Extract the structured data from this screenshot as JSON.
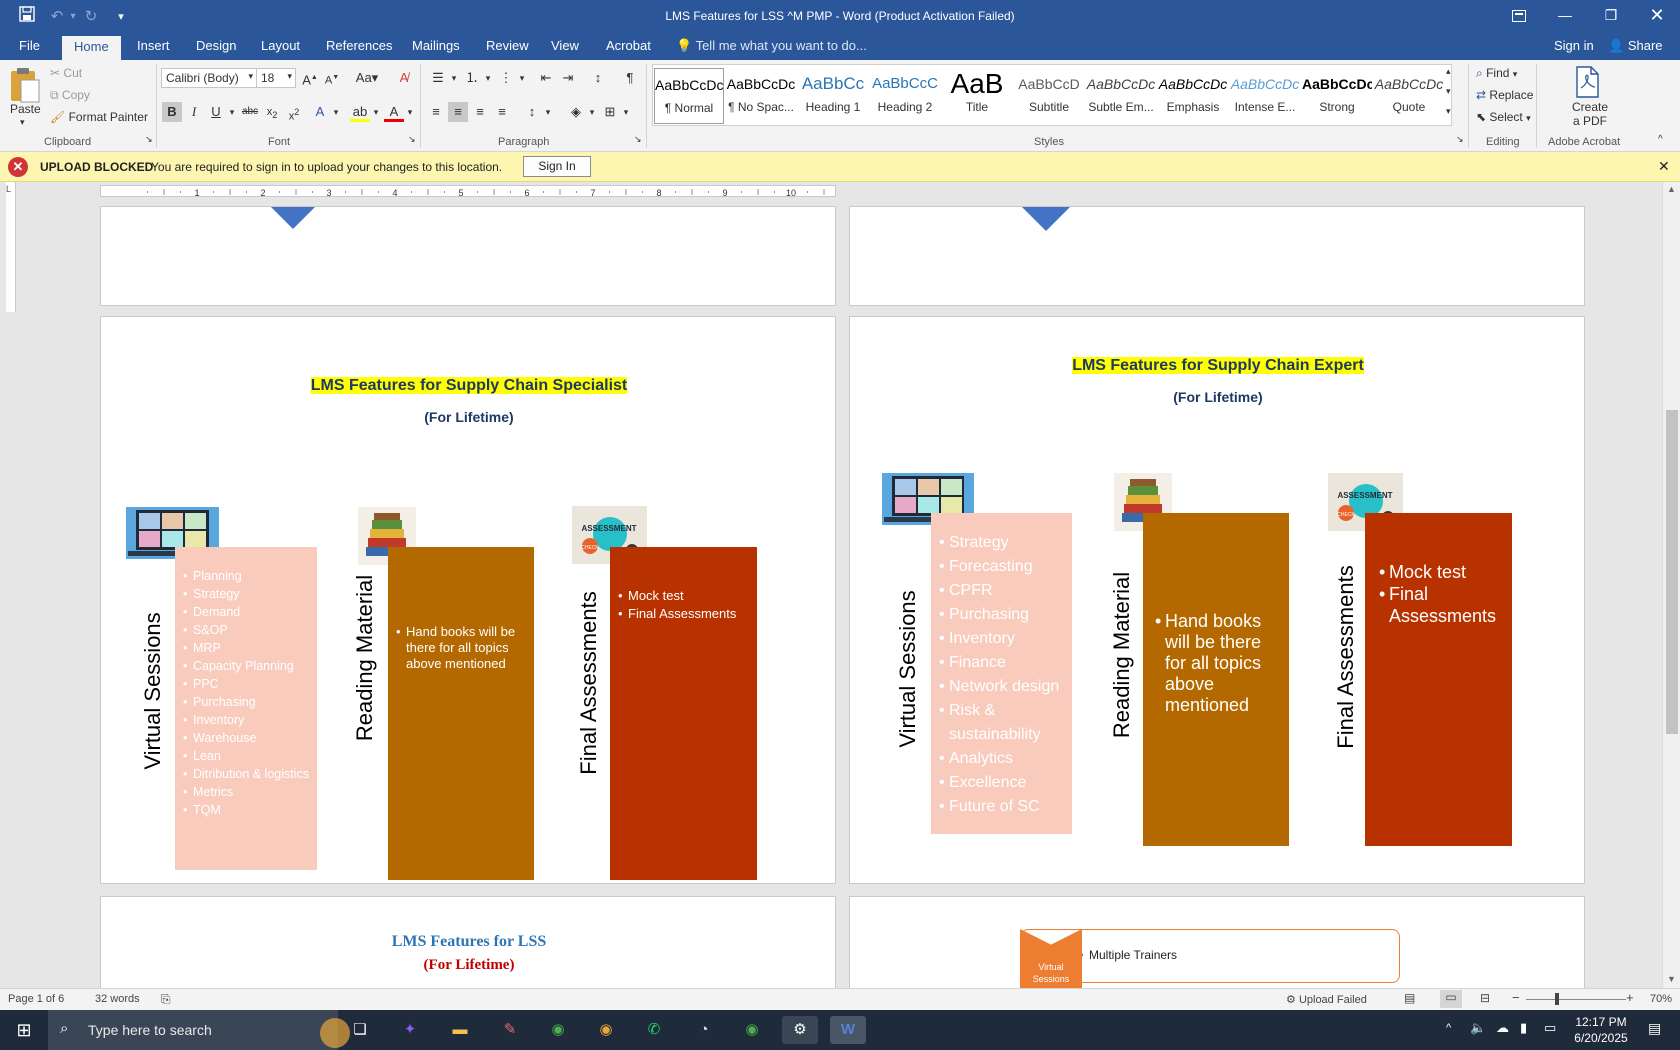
{
  "window": {
    "title": "LMS Features for LSS ^M PMP - Word (Product Activation Failed)"
  },
  "tabs": [
    "File",
    "Home",
    "Insert",
    "Design",
    "Layout",
    "References",
    "Mailings",
    "Review",
    "View",
    "Acrobat"
  ],
  "active_tab": "Home",
  "tell_me": "Tell me what you want to do...",
  "account": {
    "sign_in": "Sign in",
    "share": "Share"
  },
  "clipboard": {
    "paste": "Paste",
    "cut": "Cut",
    "copy": "Copy",
    "format_painter": "Format Painter",
    "label": "Clipboard"
  },
  "font": {
    "family": "Calibri (Body)",
    "size": "18",
    "label": "Font"
  },
  "paragraph": {
    "label": "Paragraph"
  },
  "styles": {
    "label": "Styles",
    "items": [
      {
        "preview": "AaBbCcDc",
        "name": "¶ Normal"
      },
      {
        "preview": "AaBbCcDc",
        "name": "¶ No Spac..."
      },
      {
        "preview": "AaBbCc",
        "name": "Heading 1"
      },
      {
        "preview": "AaBbCcC",
        "name": "Heading 2"
      },
      {
        "preview": "AaB",
        "name": "Title"
      },
      {
        "preview": "AaBbCcD",
        "name": "Subtitle"
      },
      {
        "preview": "AaBbCcDc",
        "name": "Subtle Em..."
      },
      {
        "preview": "AaBbCcDc",
        "name": "Emphasis"
      },
      {
        "preview": "AaBbCcDc",
        "name": "Intense E..."
      },
      {
        "preview": "AaBbCcDc",
        "name": "Strong"
      },
      {
        "preview": "AaBbCcDc",
        "name": "Quote"
      }
    ]
  },
  "editing": {
    "find": "Find",
    "replace": "Replace",
    "select": "Select",
    "label": "Editing"
  },
  "acrobat": {
    "create": "Create",
    "apdf": "a PDF",
    "label": "Adobe Acrobat"
  },
  "message_bar": {
    "title": "UPLOAD BLOCKED",
    "text": "You are required to sign in to upload your changes to this location.",
    "button": "Sign In"
  },
  "ruler": [
    "1",
    "2",
    "3",
    "4",
    "5",
    "6",
    "7",
    "8",
    "9",
    "10"
  ],
  "left_page": {
    "title": "LMS Features for Supply Chain Specialist",
    "subtitle": "(For Lifetime)",
    "col1_label": "Virtual Sessions",
    "col1_items": [
      "Planning",
      "Strategy",
      "Demand",
      "S&OP",
      "MRP",
      "Capacity Planning",
      "PPC",
      "Purchasing",
      "Inventory",
      "Warehouse",
      "Lean",
      "Ditribution & logistics",
      "Metrics",
      "TQM"
    ],
    "col2_label": "Reading Material",
    "col2_items": [
      "Hand books will be there for all topics above mentioned"
    ],
    "col3_label": "Final Assessments",
    "col3_items": [
      "Mock test",
      "Final Assessments"
    ]
  },
  "right_page": {
    "title": "LMS Features for Supply Chain Expert",
    "subtitle": "(For Lifetime)",
    "col1_label": "Virtual Sessions",
    "col1_items": [
      "Strategy",
      "Forecasting",
      "CPFR",
      "Purchasing",
      "Inventory",
      "Finance",
      "Network design",
      "Risk & sustainability",
      "Analytics",
      "Excellence",
      "Future of SC"
    ],
    "col2_label": "Reading Material",
    "col2_items": [
      "Hand books will be there for all topics above mentioned"
    ],
    "col3_label": "Final Assessments",
    "col3_items": [
      "Mock test",
      "Final Assessments"
    ]
  },
  "bottom_left": {
    "title": "LMS Features for LSS",
    "subtitle": "(For Lifetime)"
  },
  "bottom_right": {
    "chip": "Virtual Sessions",
    "item": "Multiple Trainers"
  },
  "thumb_text": {
    "assessment": "ASSESSMENT",
    "check": "CHECK"
  },
  "status": {
    "page": "Page 1 of 6",
    "words": "32 words",
    "upload": "Upload Failed",
    "zoom": "70%"
  },
  "taskbar": {
    "search": "Type here to search",
    "time": "12:17 PM",
    "date": "6/20/2025"
  },
  "colors": {
    "word_blue": "#2b579a",
    "highlight": "#ffff00",
    "title_navy": "#1f3864",
    "pink_box": "#f8cbbd",
    "brown_box": "#b36800",
    "red_box": "#b83200",
    "arrow_blue": "#4472c4",
    "bottom_title": "#2e75b6",
    "bottom_subtitle": "#c00000",
    "chip_orange": "#ed7d31"
  }
}
